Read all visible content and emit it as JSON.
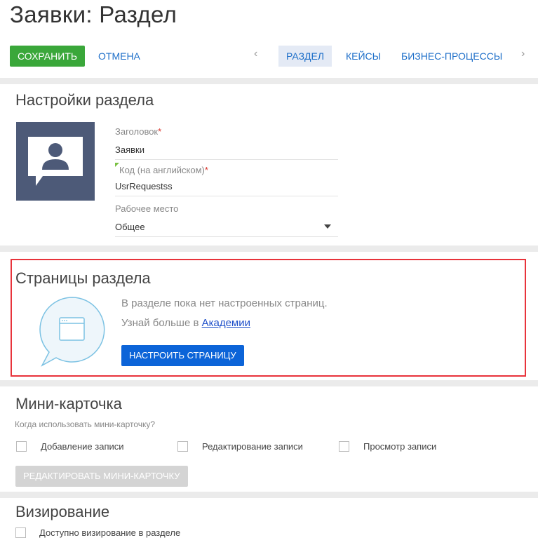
{
  "page": {
    "title": "Заявки: Раздел"
  },
  "toolbar": {
    "save_label": "СОХРАНИТЬ",
    "cancel_label": "ОТМЕНА",
    "prev_arrow": "‹",
    "next_arrow": "›",
    "tabs": [
      {
        "label": "РАЗДЕЛ",
        "active": true
      },
      {
        "label": "КЕЙСЫ",
        "active": false
      },
      {
        "label": "БИЗНЕС-ПРОЦЕССЫ",
        "active": false
      }
    ]
  },
  "settings": {
    "title": "Настройки раздела",
    "icon": "user-chat-icon",
    "fields": {
      "heading_label": "Заголовок",
      "heading_value": "Заявки",
      "code_label": "Код (на английском)",
      "code_value": "UsrRequestss",
      "workplace_label": "Рабочее место",
      "workplace_value": "Общее",
      "required_mark": "*"
    }
  },
  "pages": {
    "title": "Страницы раздела",
    "empty_text": "В разделе пока нет настроенных страниц.",
    "learn_prefix": "Узнай больше в ",
    "learn_link": "Академии",
    "configure_button": "НАСТРОИТЬ СТРАНИЦУ",
    "icon": "page-bubble-icon"
  },
  "mini_card": {
    "title": "Мини-карточка",
    "hint": "Когда использовать мини-карточку?",
    "options": [
      {
        "label": "Добавление записи",
        "checked": false
      },
      {
        "label": "Редактирование записи",
        "checked": false
      },
      {
        "label": "Просмотр записи",
        "checked": false
      }
    ],
    "edit_button": "РЕДАКТИРОВАТЬ МИНИ-КАРТОЧКУ"
  },
  "approval": {
    "title": "Визирование",
    "option": "Доступно визирование в разделе",
    "checked": false
  },
  "colors": {
    "save": "#3aa73a",
    "primary": "#0c64d8",
    "highlight_border": "#e8333b",
    "icon_bg": "#4d5a78"
  }
}
